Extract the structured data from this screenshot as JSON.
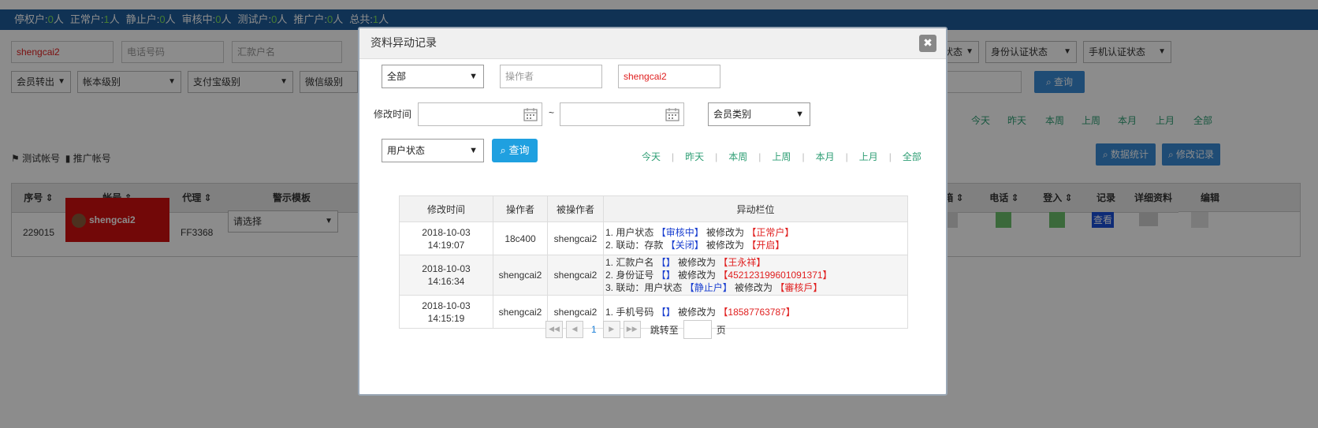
{
  "status_bar": {
    "stats": [
      {
        "label": "停权户:",
        "value": "0",
        "unit": "人"
      },
      {
        "label": "正常户:",
        "value": "1",
        "unit": "人"
      },
      {
        "label": "静止户:",
        "value": "0",
        "unit": "人"
      },
      {
        "label": "审核中:",
        "value": "0",
        "unit": "人"
      },
      {
        "label": "测试户:",
        "value": "0",
        "unit": "人"
      },
      {
        "label": "推广户:",
        "value": "0",
        "unit": "人"
      },
      {
        "label": "总共:",
        "value": "1",
        "unit": "人"
      }
    ]
  },
  "filters": {
    "account_value": "shengcai2",
    "phone_placeholder": "电话号码",
    "remitter_placeholder": "汇款户名",
    "member_transfer": "会员转出",
    "account_level": "帐本级别",
    "alipay_level": "支付宝级别",
    "wechat_level": "微信级别",
    "user_status": "用户状态",
    "id_status": "身份认证状态",
    "phone_status": "手机认证状态",
    "tilde": "~",
    "query_label": "查询",
    "quick_ranges": [
      "今天",
      "昨天",
      "本周",
      "上周",
      "本月",
      "上月",
      "全部"
    ],
    "legend_test": "测试帐号",
    "legend_promo": "推广帐号",
    "stats_button": "数据统计",
    "changelog_button": "修改记录"
  },
  "main_table": {
    "headers": {
      "seq": "序号",
      "account": "帐号",
      "agent": "代理",
      "warning": "警示模板",
      "ben": "本",
      "email": "邮箱",
      "phone": "电话",
      "login": "登入",
      "record": "记录",
      "detail": "详细资料",
      "edit": "编辑"
    },
    "row": {
      "seq": "229015",
      "account": "shengcai2",
      "agent": "FF3368",
      "warning_select": "请选择",
      "record_button": "查看"
    }
  },
  "modal": {
    "title": "资料异动记录",
    "close": "✖",
    "scope_select": "全部",
    "operator_placeholder": "操作者",
    "operated_value": "shengcai2",
    "modify_time_label": "修改时间",
    "tilde": "~",
    "member_type_select": "会员类别",
    "user_status_select": "用户状态",
    "query_label": "查询",
    "quick_ranges": [
      "今天",
      "昨天",
      "本周",
      "上周",
      "本月",
      "上月",
      "全部"
    ],
    "table": {
      "headers": [
        "修改时间",
        "操作者",
        "被操作者",
        "异动栏位"
      ],
      "rows": [
        {
          "date": "2018-10-03",
          "time": "14:19:07",
          "operator": "18c400",
          "target": "shengcai2",
          "changes": [
            {
              "prefix": "1. 用户状态",
              "old": "【审核中】",
              "mid": "被修改为",
              "new": "【正常户】"
            },
            {
              "prefix": "2. 联动：存款",
              "old": "【关闭】",
              "mid": "被修改为",
              "new": "【开启】"
            }
          ]
        },
        {
          "date": "2018-10-03",
          "time": "14:16:34",
          "operator": "shengcai2",
          "target": "shengcai2",
          "changes": [
            {
              "prefix": "1. 汇款户名",
              "old": "【】",
              "mid": "被修改为",
              "new": "【王永祥】"
            },
            {
              "prefix": "2. 身份证号",
              "old": "【】",
              "mid": "被修改为",
              "new": "【452123199601091371】"
            },
            {
              "prefix": "3. 联动：用户状态",
              "old": "【静止户】",
              "mid": "被修改为",
              "new": "【審核戶】"
            }
          ]
        },
        {
          "date": "2018-10-03",
          "time": "14:15:19",
          "operator": "shengcai2",
          "target": "shengcai2",
          "changes": [
            {
              "prefix": "1. 手机号码",
              "old": "【】",
              "mid": "被修改为",
              "new": "【18587763787】"
            }
          ]
        }
      ]
    },
    "pager": {
      "current_page": "1",
      "jump_label": "跳转至",
      "page_unit": "页"
    }
  }
}
